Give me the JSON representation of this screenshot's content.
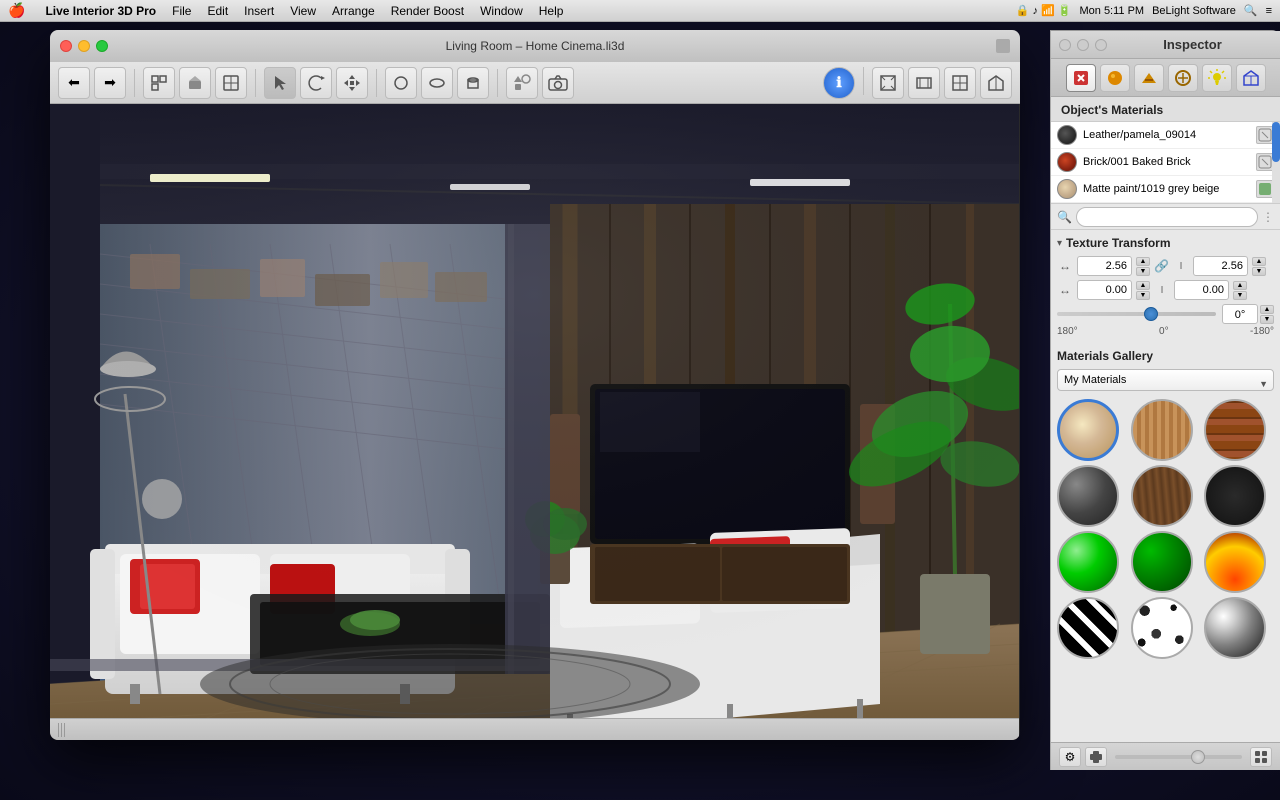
{
  "menubar": {
    "apple": "🍎",
    "app_name": "Live Interior 3D Pro",
    "menus": [
      "File",
      "Edit",
      "Insert",
      "View",
      "Arrange",
      "Render Boost",
      "Window",
      "Help"
    ],
    "right": {
      "time": "Mon 5:11 PM",
      "company": "BeLight Software"
    }
  },
  "window": {
    "title": "Living Room – Home Cinema.li3d",
    "traffic_lights": [
      "close",
      "minimize",
      "maximize"
    ]
  },
  "toolbar": {
    "nav_back_label": "←",
    "nav_forward_label": "→",
    "buttons": [
      "floor-plan",
      "3d-view",
      "overview",
      "select",
      "rotate",
      "move",
      "sphere",
      "ring",
      "cylinder",
      "object",
      "camera",
      "perspective",
      "elevation",
      "top-view",
      "room-view"
    ],
    "nav_label": "ℹ"
  },
  "inspector": {
    "title": "Inspector",
    "tabs": [
      "materials-red",
      "sphere-orange",
      "paint-yellow",
      "texture-brown",
      "light-yellow",
      "house-blue"
    ],
    "objects_materials_title": "Object's Materials",
    "materials": [
      {
        "name": "Leather/pamela_09014",
        "swatch_class": "mat-leather",
        "selected": false
      },
      {
        "name": "Brick/001 Baked Brick",
        "swatch_class": "mat-red-brick",
        "selected": false
      },
      {
        "name": "Matte paint/1019 grey beige",
        "swatch_class": "mat-beige",
        "selected": false
      }
    ],
    "search_placeholder": "",
    "texture_transform": {
      "title": "Texture Transform",
      "x_scale": "2.56",
      "y_scale": "2.56",
      "x_offset": "0.00",
      "y_offset": "0.00",
      "angle": "0°",
      "slider_min": "180°",
      "slider_mid": "0°",
      "slider_max": "-180°"
    },
    "gallery": {
      "title": "Materials Gallery",
      "dropdown_value": "My Materials",
      "items": [
        {
          "class": "mat-cream",
          "selected": true
        },
        {
          "class": "mat-wood-light",
          "selected": false
        },
        {
          "class": "mat-brick",
          "selected": false
        },
        {
          "class": "mat-metal-dark",
          "selected": false
        },
        {
          "class": "mat-wood-dark",
          "selected": false
        },
        {
          "class": "mat-dark-rough",
          "selected": false
        },
        {
          "class": "mat-green-shiny",
          "selected": false
        },
        {
          "class": "mat-green-deep",
          "selected": false
        },
        {
          "class": "mat-fire",
          "selected": false
        },
        {
          "class": "mat-zebra",
          "selected": false
        },
        {
          "class": "mat-dalmatian",
          "selected": false
        },
        {
          "class": "mat-chrome",
          "selected": false
        }
      ]
    }
  }
}
